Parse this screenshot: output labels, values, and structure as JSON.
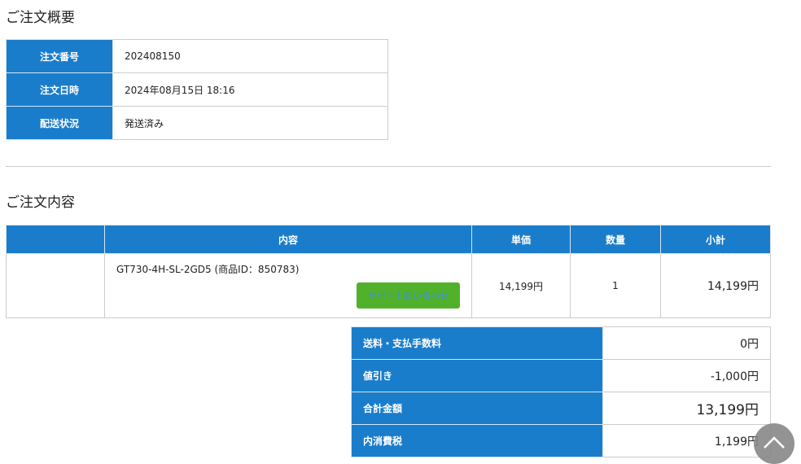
{
  "summary": {
    "title": "ご注文概要",
    "rows": [
      {
        "label": "注文番号",
        "value": "202408150"
      },
      {
        "label": "注文日時",
        "value": "2024年08月15日 18:16"
      },
      {
        "label": "配送状況",
        "value": "発送済み"
      }
    ]
  },
  "details": {
    "title": "ご注文内容",
    "headers": [
      "",
      "内容",
      "単価",
      "数量",
      "小計"
    ],
    "items": [
      {
        "name": "GT730-4H-SL-2GD5 (商品ID：850783)",
        "support_button": "サポート問い合わせ",
        "unit_price": "14,199円",
        "quantity": "1",
        "subtotal": "14,199円"
      }
    ]
  },
  "totals": [
    {
      "label": "送料・支払手数料",
      "value": "0円"
    },
    {
      "label": "値引き",
      "value": "-1,000円"
    },
    {
      "label": "合計金額",
      "value": "13,199円"
    },
    {
      "label": "内消費税",
      "value": "1,199円"
    }
  ],
  "colors": {
    "header": "#1a7dcb",
    "button": "#52b12a"
  }
}
